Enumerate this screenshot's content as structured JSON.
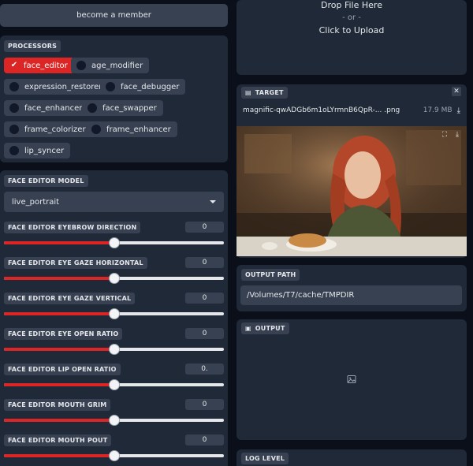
{
  "header": {
    "member_label": "become a member"
  },
  "processors": {
    "title": "PROCESSORS",
    "items": [
      {
        "label": "face_editor",
        "active": true
      },
      {
        "label": "age_modifier",
        "active": false
      },
      {
        "label": "expression_restorer",
        "active": false
      },
      {
        "label": "face_debugger",
        "active": false
      },
      {
        "label": "face_enhancer",
        "active": false
      },
      {
        "label": "face_swapper",
        "active": false
      },
      {
        "label": "frame_colorizer",
        "active": false
      },
      {
        "label": "frame_enhancer",
        "active": false
      },
      {
        "label": "lip_syncer",
        "active": false
      }
    ]
  },
  "face_editor": {
    "model_title": "FACE EDITOR MODEL",
    "model_value": "live_portrait",
    "sliders": [
      {
        "label": "FACE EDITOR EYEBROW DIRECTION",
        "value": "0",
        "fraction": 0.5
      },
      {
        "label": "FACE EDITOR EYE GAZE HORIZONTAL",
        "value": "0",
        "fraction": 0.5
      },
      {
        "label": "FACE EDITOR EYE GAZE VERTICAL",
        "value": "0",
        "fraction": 0.5
      },
      {
        "label": "FACE EDITOR EYE OPEN RATIO",
        "value": "0",
        "fraction": 0.5
      },
      {
        "label": "FACE EDITOR LIP OPEN RATIO",
        "value": "0.",
        "fraction": 0.5
      },
      {
        "label": "FACE EDITOR MOUTH GRIM",
        "value": "0",
        "fraction": 0.5
      },
      {
        "label": "FACE EDITOR MOUTH POUT",
        "value": "0",
        "fraction": 0.5
      }
    ]
  },
  "upload": {
    "line1": "Drop File Here",
    "line2": "- or -",
    "line3": "Click to Upload"
  },
  "target": {
    "title": "TARGET",
    "file_name": "magnific-qwADGb6m1oLYrmnB6QpR-... .png",
    "file_size": "17.9 MB"
  },
  "output_path": {
    "title": "OUTPUT PATH",
    "value": "/Volumes/T7/cache/TMPDIR"
  },
  "output": {
    "title": "OUTPUT"
  },
  "log_level": {
    "title": "LOG LEVEL"
  },
  "colors": {
    "accent": "#dc2626",
    "panel": "#1f2937",
    "background": "#0b0f19"
  }
}
